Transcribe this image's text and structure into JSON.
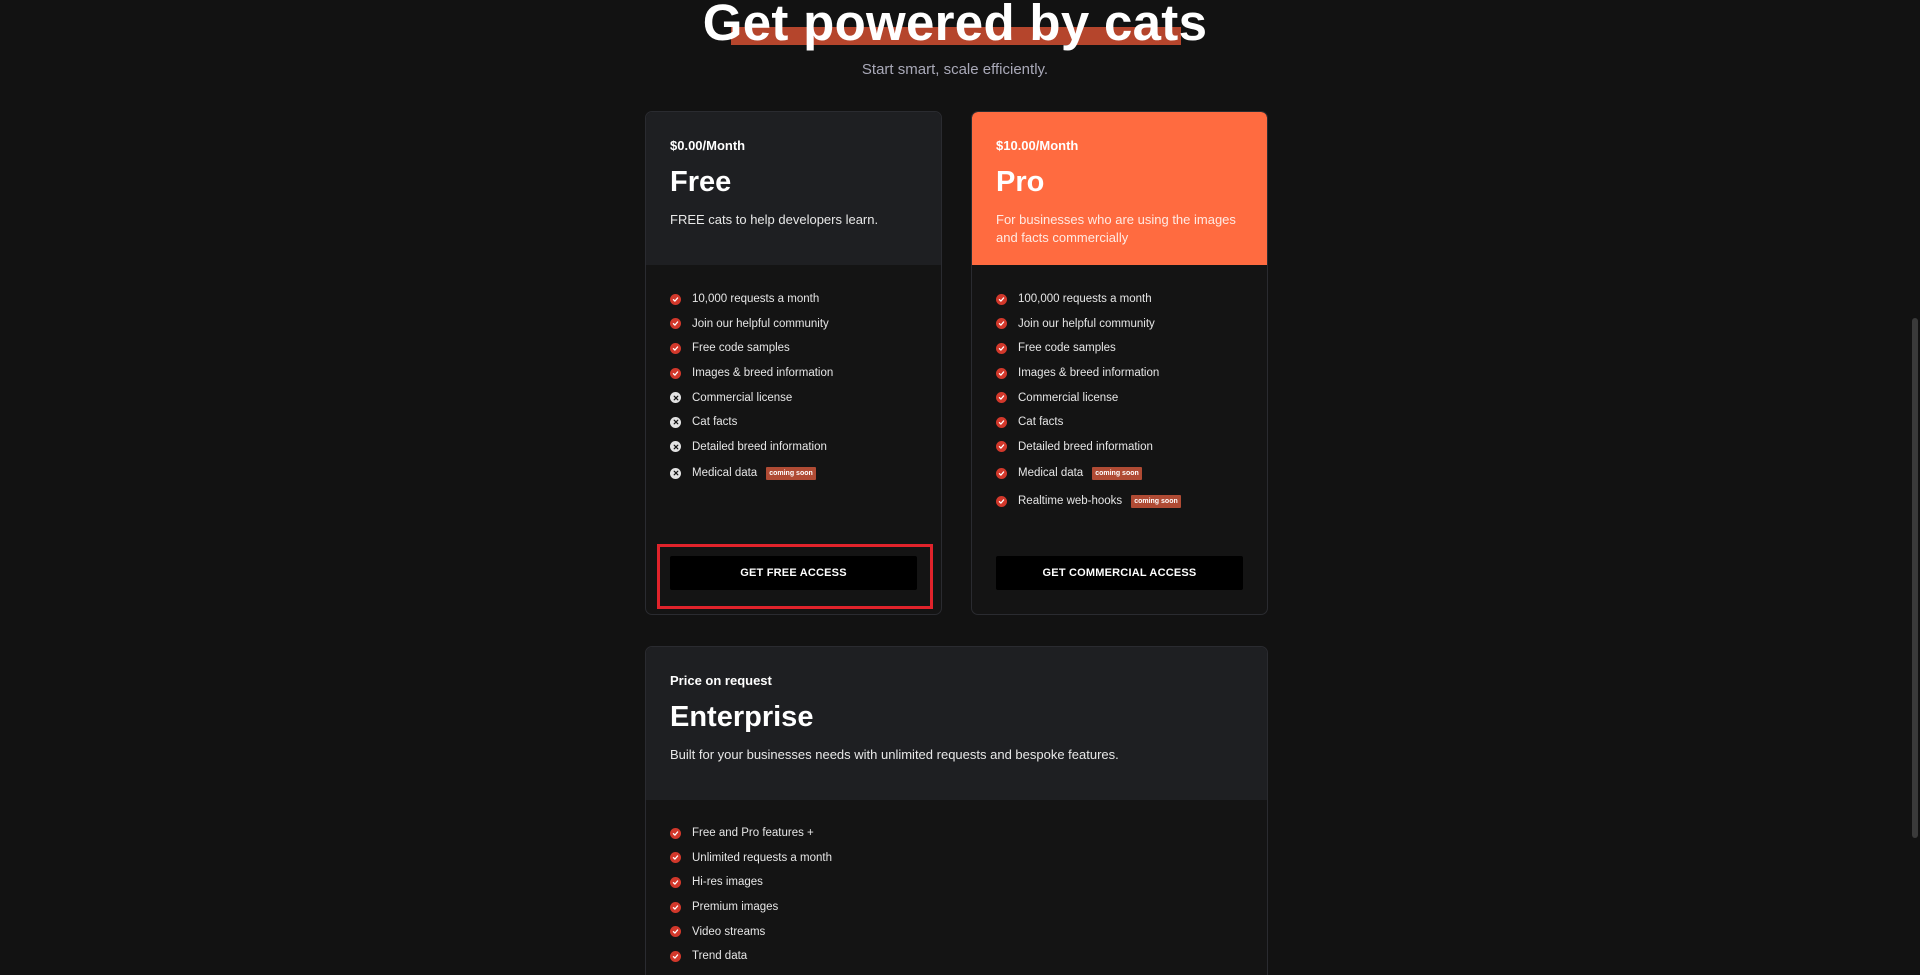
{
  "header": {
    "title": "Get powered by cats",
    "subtitle": "Start smart, scale efficiently."
  },
  "colors": {
    "background": "#121212",
    "accent": "#ff6b40",
    "check": "#d2382b",
    "badge": "#b04b34",
    "highlight": "#e0232b"
  },
  "plans": {
    "free": {
      "price": "$0.00/Month",
      "name": "Free",
      "description": "FREE cats to help developers learn.",
      "features": [
        {
          "label": "10,000 requests a month",
          "included": true
        },
        {
          "label": "Join our helpful community",
          "included": true
        },
        {
          "label": "Free code samples",
          "included": true
        },
        {
          "label": "Images & breed information",
          "included": true
        },
        {
          "label": "Commercial license",
          "included": false
        },
        {
          "label": "Cat facts",
          "included": false
        },
        {
          "label": "Detailed breed information",
          "included": false
        },
        {
          "label": "Medical data",
          "included": false,
          "badge": "coming soon"
        }
      ],
      "cta": "GET FREE ACCESS"
    },
    "pro": {
      "price": "$10.00/Month",
      "name": "Pro",
      "description": "For businesses who are using the images and facts commercially",
      "features": [
        {
          "label": "100,000 requests a month",
          "included": true
        },
        {
          "label": "Join our helpful community",
          "included": true
        },
        {
          "label": "Free code samples",
          "included": true
        },
        {
          "label": "Images & breed information",
          "included": true
        },
        {
          "label": "Commercial license",
          "included": true
        },
        {
          "label": "Cat facts",
          "included": true
        },
        {
          "label": "Detailed breed information",
          "included": true
        },
        {
          "label": "Medical data",
          "included": true,
          "badge": "coming soon"
        },
        {
          "label": "Realtime web-hooks",
          "included": true,
          "badge": "coming soon"
        }
      ],
      "cta": "GET COMMERCIAL ACCESS"
    },
    "enterprise": {
      "price": "Price on request",
      "name": "Enterprise",
      "description": "Built for your businesses needs with unlimited requests and bespoke features.",
      "features": [
        {
          "label": "Free and Pro features +",
          "included": true
        },
        {
          "label": "Unlimited requests a month",
          "included": true
        },
        {
          "label": "Hi-res images",
          "included": true
        },
        {
          "label": "Premium images",
          "included": true
        },
        {
          "label": "Video streams",
          "included": true
        },
        {
          "label": "Trend data",
          "included": true
        }
      ]
    }
  }
}
